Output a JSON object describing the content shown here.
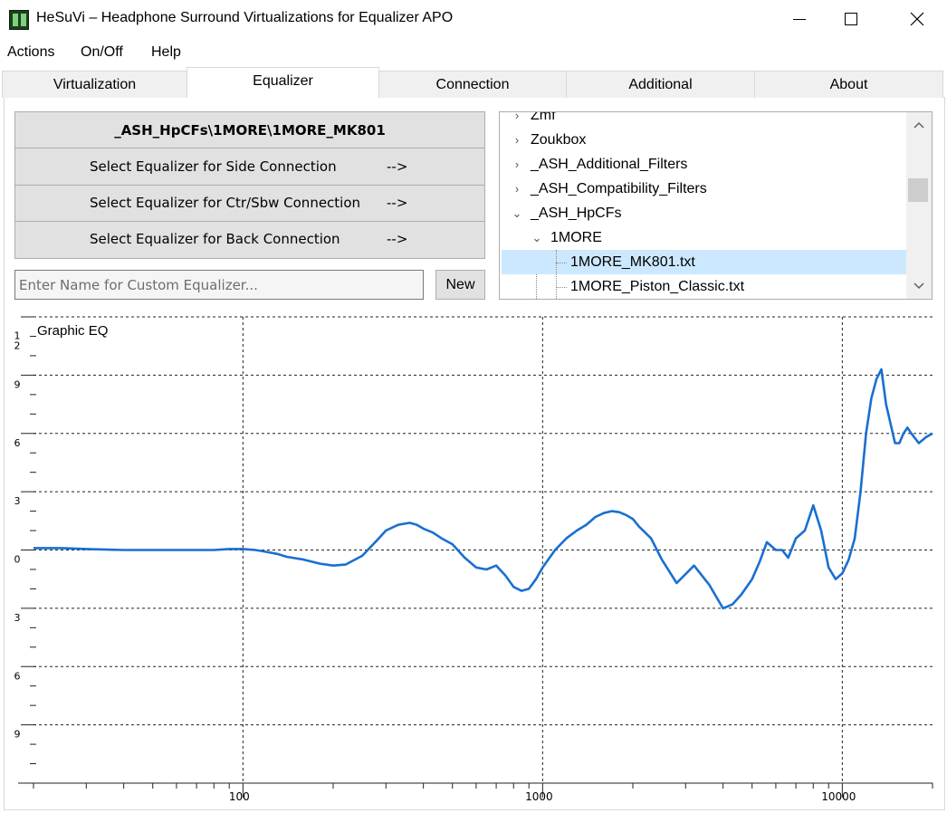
{
  "window": {
    "title": "HeSuVi – Headphone Surround Virtualizations for Equalizer APO"
  },
  "menu": [
    "Actions",
    "On/Off",
    "Help"
  ],
  "tabs": [
    {
      "label": "Virtualization",
      "active": false
    },
    {
      "label": "Equalizer",
      "active": true
    },
    {
      "label": "Connection",
      "active": false
    },
    {
      "label": "Additional",
      "active": false
    },
    {
      "label": "About",
      "active": false
    }
  ],
  "equalizer": {
    "current": "_ASH_HpCFs\\1MORE\\1MORE_MK801",
    "buttons": [
      {
        "label": "Select Equalizer for Side Connection",
        "arrow": "-->"
      },
      {
        "label": "Select Equalizer for Ctr/Sbw Connection",
        "arrow": "-->"
      },
      {
        "label": "Select Equalizer for Back Connection",
        "arrow": "-->"
      }
    ],
    "custom_placeholder": "Enter Name for Custom Equalizer...",
    "new_label": "New"
  },
  "tree": {
    "items": [
      {
        "label": "Zmf",
        "expanded": false,
        "level": 0
      },
      {
        "label": "Zoukbox",
        "expanded": false,
        "level": 0
      },
      {
        "label": "_ASH_Additional_Filters",
        "expanded": false,
        "level": 0
      },
      {
        "label": "_ASH_Compatibility_Filters",
        "expanded": false,
        "level": 0
      },
      {
        "label": "_ASH_HpCFs",
        "expanded": true,
        "level": 0
      },
      {
        "label": "1MORE",
        "expanded": true,
        "level": 1
      },
      {
        "label": "1MORE_MK801.txt",
        "selected": true,
        "level": 2
      },
      {
        "label": "1MORE_Piston_Classic.txt",
        "selected": false,
        "level": 2
      }
    ]
  },
  "chart_data": {
    "type": "line",
    "title": "Graphic EQ",
    "x_scale": "log",
    "xlim": [
      20,
      20000
    ],
    "ylim": [
      -12,
      12
    ],
    "x_tick_labels": [
      "100",
      "1000",
      "10000"
    ],
    "x_major_ticks": [
      100,
      1000,
      10000
    ],
    "y_tick_labels": [
      {
        "value": 11.5,
        "label": "1"
      },
      {
        "value": 11,
        "label": "2"
      },
      {
        "value": 9,
        "label": "9"
      },
      {
        "value": 6,
        "label": "6"
      },
      {
        "value": 3,
        "label": "3"
      },
      {
        "value": 0,
        "label": "0"
      },
      {
        "value": -3,
        "label": "3"
      },
      {
        "value": -6,
        "label": "6"
      },
      {
        "value": -9,
        "label": "9"
      }
    ],
    "y_gridlines": [
      12,
      9,
      6,
      3,
      0,
      -3,
      -6,
      -9,
      -12
    ],
    "grid": true,
    "line_color": "#1a6fd0",
    "series": [
      {
        "x": [
          20,
          25,
          30,
          40,
          50,
          60,
          70,
          80,
          90,
          100,
          110,
          120,
          130,
          140,
          160,
          180,
          200,
          220,
          250,
          280,
          300,
          330,
          360,
          380,
          400,
          430,
          460,
          500,
          550,
          600,
          650,
          700,
          750,
          800,
          850,
          900,
          950,
          1000,
          1100,
          1200,
          1300,
          1400,
          1500,
          1600,
          1700,
          1800,
          1900,
          2000,
          2100,
          2300,
          2500,
          2800,
          3200,
          3600,
          4000,
          4300,
          4600,
          5000,
          5300,
          5600,
          6000,
          6300,
          6600,
          7000,
          7500,
          8000,
          8500,
          9000,
          9500,
          10000,
          10500,
          11000,
          11500,
          12000,
          12500,
          13000,
          13500,
          14000,
          15000,
          15500,
          16000,
          16500,
          17000,
          18000,
          19000,
          20000
        ],
        "y": [
          0.1,
          0.1,
          0.05,
          0.0,
          0.0,
          0.0,
          0.0,
          0.0,
          0.05,
          0.05,
          0.0,
          -0.1,
          -0.2,
          -0.35,
          -0.5,
          -0.7,
          -0.8,
          -0.75,
          -0.3,
          0.5,
          1.0,
          1.3,
          1.4,
          1.3,
          1.1,
          0.9,
          0.6,
          0.3,
          -0.4,
          -0.9,
          -1.0,
          -0.8,
          -1.3,
          -1.9,
          -2.1,
          -2.0,
          -1.5,
          -0.9,
          0.0,
          0.6,
          1.0,
          1.3,
          1.7,
          1.9,
          2.0,
          1.95,
          1.8,
          1.6,
          1.2,
          0.6,
          -0.5,
          -1.7,
          -0.8,
          -1.8,
          -3.0,
          -2.8,
          -2.3,
          -1.5,
          -0.6,
          0.4,
          0.0,
          0.0,
          -0.4,
          0.6,
          1.0,
          2.3,
          1.0,
          -0.9,
          -1.5,
          -1.2,
          -0.5,
          0.6,
          3.0,
          6.0,
          7.8,
          8.8,
          9.3,
          7.5,
          5.5,
          5.5,
          6.0,
          6.3,
          6.0,
          5.5,
          5.8,
          6.0
        ]
      }
    ]
  }
}
